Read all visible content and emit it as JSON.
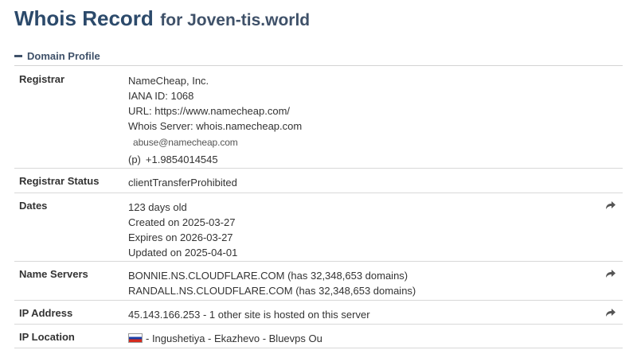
{
  "header": {
    "title": "Whois Record",
    "domain_text": "for Joven-tis.world"
  },
  "section": {
    "label": "Domain Profile"
  },
  "rows": {
    "registrar": {
      "key": "Registrar",
      "name": "NameCheap, Inc.",
      "iana": "IANA ID: 1068",
      "url": "URL: https://www.namecheap.com/",
      "whois_server": "Whois Server: whois.namecheap.com",
      "email": "abuse@namecheap.com",
      "phone_prefix": "(p)",
      "phone": "+1.9854014545"
    },
    "status": {
      "key": "Registrar Status",
      "value": "clientTransferProhibited"
    },
    "dates": {
      "key": "Dates",
      "age": "123 days old",
      "created": "Created on 2025-03-27",
      "expires": "Expires on 2026-03-27",
      "updated": "Updated on 2025-04-01"
    },
    "name_servers": {
      "key": "Name Servers",
      "ns1": "BONNIE.NS.CLOUDFLARE.COM (has 32,348,653 domains)",
      "ns2": "RANDALL.NS.CLOUDFLARE.COM (has 32,348,653 domains)"
    },
    "ip_address": {
      "key": "IP Address",
      "value": "45.143.166.253 - 1 other site is hosted on this server"
    },
    "ip_location": {
      "key": "IP Location",
      "value": "- Ingushetiya - Ekazhevo - Bluevps Ou"
    }
  },
  "icons": {
    "share": "share-arrow-icon",
    "flag": "russia-flag-icon"
  },
  "colors": {
    "title": "#2c4a6b",
    "section": "#3f5169",
    "divider": "#d8d8d8"
  }
}
